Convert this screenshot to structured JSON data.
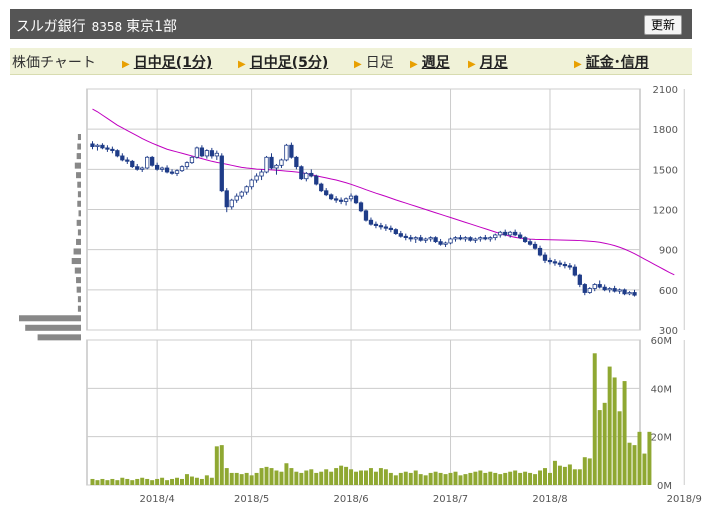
{
  "header": {
    "name": "スルガ銀行",
    "code": "8358",
    "market": "東京1部",
    "refresh_label": "更新"
  },
  "tabs": [
    {
      "label": "株価チャート",
      "link": false,
      "arrow": false
    },
    {
      "label": "日中足(1分)",
      "link": true,
      "arrow": true
    },
    {
      "label": "日中足(5分)",
      "link": true,
      "arrow": true
    },
    {
      "label": "日足",
      "link": false,
      "arrow": true
    },
    {
      "label": "週足",
      "link": true,
      "arrow": true
    },
    {
      "label": "月足",
      "link": true,
      "arrow": true
    },
    {
      "label": "証金･信用",
      "link": true,
      "arrow": true
    }
  ],
  "colors": {
    "candle_up": "#ffffff",
    "candle_down": "#1f3c88",
    "candle_outline": "#1f3c88",
    "ma_line": "#c000c0",
    "volume_bar": "#8fa832",
    "grid": "#cccccc",
    "volume_profile": "#888888"
  },
  "chart_data": [
    {
      "type": "candlestick",
      "title": "",
      "ylim": [
        300,
        2100
      ],
      "y_ticks": [
        300,
        600,
        900,
        1200,
        1500,
        1800,
        2100
      ],
      "x_ticks": [
        "2018/4",
        "2018/5",
        "2018/6",
        "2018/7",
        "2018/8",
        "2018/9"
      ],
      "x_tick_index": [
        13,
        32,
        52,
        72,
        92,
        119
      ],
      "ohlc": [
        [
          1690,
          1710,
          1650,
          1670
        ],
        [
          1670,
          1690,
          1640,
          1680
        ],
        [
          1680,
          1695,
          1650,
          1660
        ],
        [
          1660,
          1680,
          1630,
          1650
        ],
        [
          1650,
          1670,
          1620,
          1640
        ],
        [
          1640,
          1650,
          1590,
          1600
        ],
        [
          1600,
          1620,
          1560,
          1570
        ],
        [
          1570,
          1590,
          1540,
          1560
        ],
        [
          1560,
          1570,
          1510,
          1520
        ],
        [
          1520,
          1540,
          1490,
          1500
        ],
        [
          1500,
          1520,
          1480,
          1510
        ],
        [
          1510,
          1600,
          1500,
          1590
        ],
        [
          1590,
          1600,
          1520,
          1530
        ],
        [
          1530,
          1550,
          1490,
          1500
        ],
        [
          1500,
          1520,
          1480,
          1510
        ],
        [
          1510,
          1530,
          1470,
          1480
        ],
        [
          1480,
          1500,
          1460,
          1470
        ],
        [
          1470,
          1500,
          1450,
          1490
        ],
        [
          1490,
          1530,
          1480,
          1520
        ],
        [
          1520,
          1560,
          1500,
          1550
        ],
        [
          1550,
          1600,
          1540,
          1590
        ],
        [
          1590,
          1670,
          1580,
          1660
        ],
        [
          1660,
          1680,
          1590,
          1600
        ],
        [
          1600,
          1650,
          1580,
          1640
        ],
        [
          1640,
          1660,
          1580,
          1600
        ],
        [
          1600,
          1640,
          1570,
          1620
        ],
        [
          1600,
          1620,
          1330,
          1340
        ],
        [
          1340,
          1360,
          1180,
          1220
        ],
        [
          1220,
          1280,
          1200,
          1270
        ],
        [
          1270,
          1320,
          1250,
          1300
        ],
        [
          1300,
          1340,
          1280,
          1330
        ],
        [
          1330,
          1380,
          1310,
          1370
        ],
        [
          1370,
          1430,
          1350,
          1420
        ],
        [
          1420,
          1470,
          1400,
          1450
        ],
        [
          1450,
          1500,
          1420,
          1480
        ],
        [
          1480,
          1600,
          1470,
          1590
        ],
        [
          1590,
          1620,
          1500,
          1510
        ],
        [
          1510,
          1540,
          1460,
          1530
        ],
        [
          1530,
          1580,
          1510,
          1570
        ],
        [
          1570,
          1690,
          1560,
          1680
        ],
        [
          1680,
          1700,
          1580,
          1590
        ],
        [
          1590,
          1600,
          1500,
          1520
        ],
        [
          1520,
          1530,
          1420,
          1430
        ],
        [
          1430,
          1480,
          1410,
          1470
        ],
        [
          1470,
          1500,
          1440,
          1450
        ],
        [
          1450,
          1460,
          1380,
          1390
        ],
        [
          1390,
          1400,
          1330,
          1340
        ],
        [
          1340,
          1360,
          1300,
          1310
        ],
        [
          1310,
          1320,
          1270,
          1280
        ],
        [
          1280,
          1300,
          1250,
          1270
        ],
        [
          1270,
          1290,
          1240,
          1260
        ],
        [
          1260,
          1290,
          1230,
          1280
        ],
        [
          1280,
          1320,
          1260,
          1300
        ],
        [
          1300,
          1310,
          1240,
          1250
        ],
        [
          1250,
          1260,
          1180,
          1190
        ],
        [
          1190,
          1200,
          1110,
          1120
        ],
        [
          1120,
          1140,
          1080,
          1090
        ],
        [
          1090,
          1110,
          1060,
          1080
        ],
        [
          1080,
          1100,
          1050,
          1070
        ],
        [
          1070,
          1090,
          1040,
          1060
        ],
        [
          1060,
          1080,
          1030,
          1050
        ],
        [
          1050,
          1060,
          1010,
          1020
        ],
        [
          1020,
          1040,
          990,
          1000
        ],
        [
          1000,
          1020,
          970,
          990
        ],
        [
          990,
          1010,
          960,
          980
        ],
        [
          980,
          1000,
          950,
          990
        ],
        [
          990,
          1010,
          960,
          970
        ],
        [
          970,
          990,
          950,
          980
        ],
        [
          980,
          1000,
          960,
          990
        ],
        [
          990,
          1000,
          950,
          960
        ],
        [
          960,
          980,
          930,
          940
        ],
        [
          940,
          960,
          920,
          950
        ],
        [
          950,
          990,
          940,
          980
        ],
        [
          980,
          1000,
          960,
          990
        ],
        [
          990,
          1010,
          970,
          980
        ],
        [
          980,
          1000,
          960,
          990
        ],
        [
          990,
          1000,
          960,
          970
        ],
        [
          970,
          990,
          950,
          980
        ],
        [
          980,
          1000,
          960,
          990
        ],
        [
          990,
          1010,
          970,
          980
        ],
        [
          980,
          1000,
          960,
          990
        ],
        [
          990,
          1020,
          970,
          1010
        ],
        [
          1010,
          1040,
          990,
          1030
        ],
        [
          1030,
          1050,
          1000,
          1010
        ],
        [
          1010,
          1040,
          990,
          1030
        ],
        [
          1030,
          1050,
          1000,
          1010
        ],
        [
          1010,
          1030,
          980,
          990
        ],
        [
          990,
          1000,
          950,
          960
        ],
        [
          960,
          980,
          930,
          940
        ],
        [
          940,
          960,
          900,
          910
        ],
        [
          910,
          930,
          850,
          860
        ],
        [
          860,
          880,
          800,
          820
        ],
        [
          820,
          840,
          790,
          810
        ],
        [
          810,
          830,
          780,
          800
        ],
        [
          800,
          820,
          770,
          790
        ],
        [
          790,
          810,
          760,
          780
        ],
        [
          780,
          800,
          750,
          770
        ],
        [
          770,
          790,
          700,
          710
        ],
        [
          710,
          720,
          620,
          640
        ],
        [
          640,
          650,
          560,
          580
        ],
        [
          580,
          620,
          570,
          610
        ],
        [
          610,
          650,
          590,
          640
        ],
        [
          640,
          670,
          610,
          620
        ],
        [
          620,
          640,
          590,
          600
        ],
        [
          600,
          620,
          580,
          610
        ],
        [
          610,
          630,
          580,
          590
        ],
        [
          590,
          610,
          570,
          600
        ],
        [
          600,
          610,
          560,
          570
        ],
        [
          570,
          590,
          560,
          580
        ],
        [
          580,
          600,
          550,
          560
        ]
      ],
      "moving_average": [
        1950,
        1930,
        1905,
        1880,
        1855,
        1830,
        1810,
        1790,
        1770,
        1750,
        1730,
        1712,
        1695,
        1680,
        1665,
        1650,
        1640,
        1630,
        1620,
        1610,
        1600,
        1590,
        1580,
        1570,
        1560,
        1552,
        1545,
        1538,
        1530,
        1522,
        1515,
        1510,
        1506,
        1502,
        1500,
        1498,
        1496,
        1493,
        1490,
        1487,
        1484,
        1480,
        1475,
        1468,
        1460,
        1452,
        1444,
        1436,
        1428,
        1420,
        1410,
        1400,
        1388,
        1375,
        1362,
        1348,
        1335,
        1322,
        1310,
        1298,
        1285,
        1272,
        1260,
        1248,
        1236,
        1224,
        1212,
        1200,
        1188,
        1176,
        1164,
        1152,
        1140,
        1128,
        1116,
        1104,
        1092,
        1080,
        1068,
        1056,
        1044,
        1032,
        1020,
        1010,
        1000,
        992,
        986,
        982,
        979,
        977,
        976,
        975,
        974,
        973,
        972,
        971,
        970,
        969,
        968,
        966,
        963,
        960,
        955,
        948,
        940,
        930,
        918,
        904,
        888,
        870,
        850,
        830,
        810,
        790,
        770,
        750,
        730,
        712
      ],
      "volume_profile": [
        0.05,
        0.06,
        0.07,
        0.1,
        0.08,
        0.06,
        0.05,
        0.06,
        0.04,
        0.07,
        0.05,
        0.08,
        0.12,
        0.15,
        0.1,
        0.08,
        0.07,
        0.05,
        0.05,
        1.0,
        0.9,
        0.7
      ]
    },
    {
      "type": "bar",
      "title": "",
      "ylim": [
        0,
        60
      ],
      "y_ticks": [
        "0M",
        "20M",
        "40M",
        "60M"
      ],
      "y_tick_values": [
        0,
        20,
        40,
        60
      ],
      "values": [
        2.5,
        2,
        2.5,
        2,
        2.5,
        2,
        3,
        2.5,
        2,
        2.5,
        3,
        2.5,
        2,
        2.5,
        3,
        2,
        2.5,
        3,
        2.5,
        4.5,
        3.5,
        3,
        2.5,
        4,
        3,
        16,
        16.5,
        7,
        5,
        5,
        4.5,
        5,
        4,
        5,
        7,
        7.5,
        7,
        6,
        5.5,
        9,
        7,
        5.5,
        5,
        6,
        6.5,
        5,
        5.5,
        6.5,
        5.5,
        7,
        8,
        7.5,
        6.5,
        5.5,
        6,
        6,
        7,
        5.5,
        7,
        6.5,
        5,
        4,
        5,
        5.5,
        5,
        6,
        4.5,
        4,
        5,
        5.5,
        5,
        4.5,
        5,
        5.5,
        4,
        4.5,
        5,
        5.5,
        6,
        5,
        5.5,
        5,
        4.5,
        5,
        5.5,
        6,
        5,
        5.5,
        5,
        4.5,
        6,
        7,
        5,
        10,
        8,
        7.5,
        8.5,
        6.5,
        6.5,
        11.5,
        11,
        54.5,
        31,
        34,
        49,
        44.5,
        30.5,
        43,
        17.5,
        16.5,
        22,
        13,
        22
      ]
    }
  ]
}
